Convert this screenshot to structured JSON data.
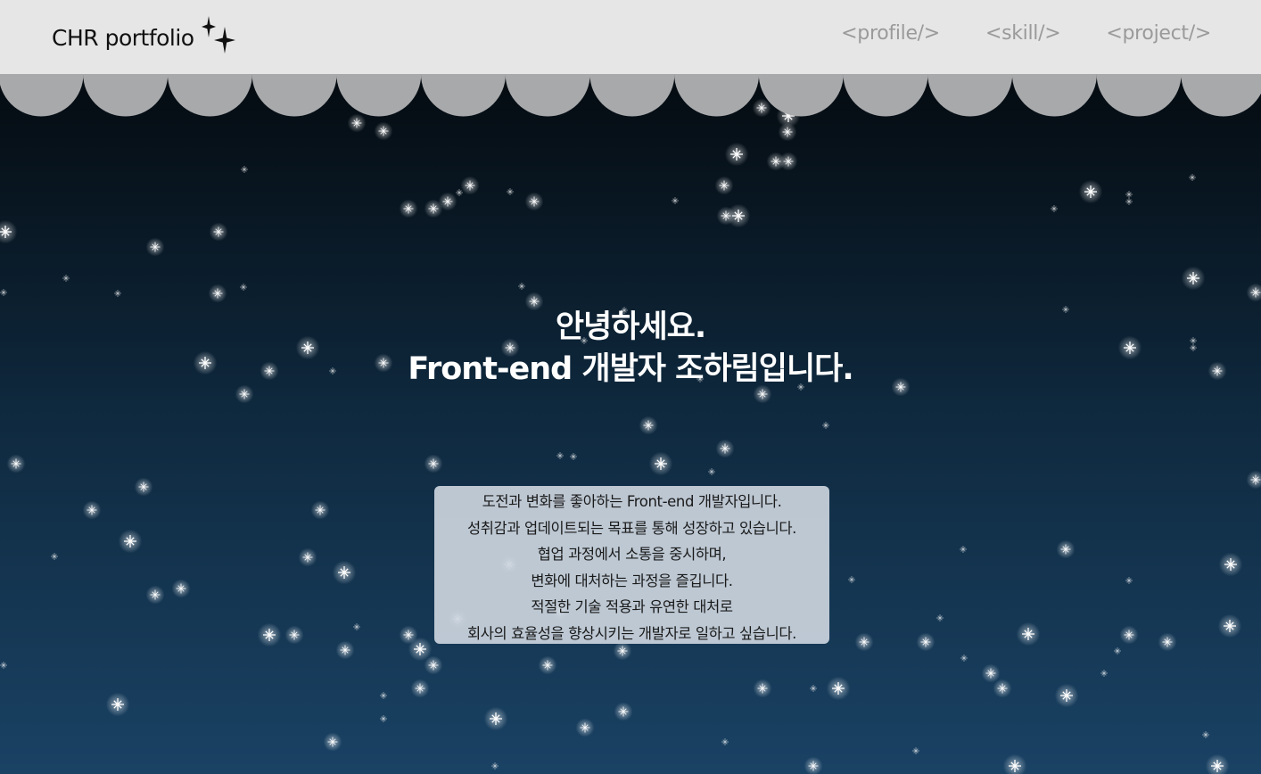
{
  "header": {
    "logo_text": "CHR portfolio",
    "nav": [
      {
        "label": "<profile/>"
      },
      {
        "label": "<skill/>"
      },
      {
        "label": "<project/>"
      }
    ]
  },
  "hero": {
    "greeting": "안녕하세요.",
    "title": "Front-end 개발자 조하림입니다."
  },
  "intro": {
    "lines": [
      "도전과 변화를 좋아하는 Front-end 개발자입니다.",
      "성취감과 업데이트되는 목표를 통해 성장하고 있습니다.",
      "협업 과정에서 소통을 중시하며,",
      "변화에 대처하는 과정을 즐깁니다.",
      "적절한 기술 적용과 유연한 대처로",
      "회사의 효율성을 향상시키는 개발자로 일하고 싶습니다."
    ]
  },
  "colors": {
    "header_bg": "#e6e6e6",
    "nav_text": "#9a9a9a",
    "scallop": "#a8a9ab",
    "sky_top": "#020507",
    "sky_bottom": "#1a4264",
    "intro_bg": "#ccd5de"
  },
  "icons": {
    "logo": "sparkle-icon",
    "background": "star-icon"
  }
}
